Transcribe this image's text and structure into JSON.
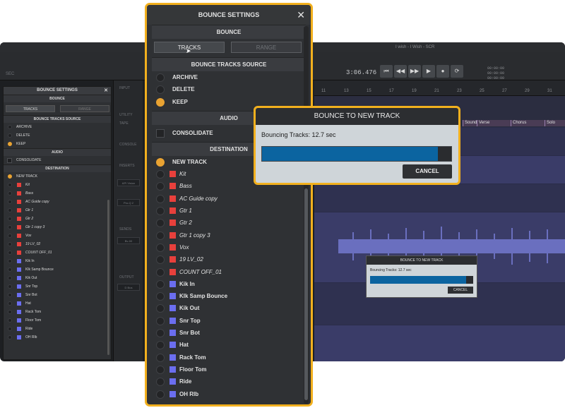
{
  "daw": {
    "window_title": "I wish - I Wish - SCR",
    "sec_label": "SEC",
    "counter": "3:06.476",
    "meta_times": [
      "00:00:00",
      "00:00:00",
      "00:00:00"
    ],
    "mid_labels": [
      "INPUT",
      "UTILITY",
      "TAPE",
      "CONSOLE",
      "INSERTS",
      "SENDS",
      "OUTPUT"
    ],
    "mid_slots": [
      "API Vision",
      "Pro-Q 2",
      "Bv-00",
      "D Bus"
    ],
    "ruler_numbers": [
      "11",
      "13",
      "15",
      "17",
      "19",
      "21",
      "23",
      "25",
      "27",
      "29",
      "31"
    ],
    "markers": [
      "Sound",
      "Verse",
      "Chorus",
      "Solo"
    ]
  },
  "small_settings": {
    "title": "BOUNCE SETTINGS",
    "section_bounce": "BOUNCE",
    "tab_tracks": "TRACKS",
    "tab_range": "RANGE",
    "section_source": "BOUNCE TRACKS SOURCE",
    "archive": "ARCHIVE",
    "delete": "DELETE",
    "keep": "KEEP",
    "section_audio": "AUDIO",
    "consolidate": "CONSOLIDATE",
    "section_destination": "DESTINATION",
    "new_track": "NEW TRACK"
  },
  "main_settings": {
    "title": "BOUNCE SETTINGS",
    "section_bounce": "BOUNCE",
    "tab_tracks": "TRACKS",
    "tab_range": "RANGE",
    "section_source": "BOUNCE TRACKS SOURCE",
    "archive": "ARCHIVE",
    "delete": "DELETE",
    "keep": "KEEP",
    "section_audio": "AUDIO",
    "consolidate": "CONSOLIDATE",
    "section_destination": "DESTINATION",
    "new_track": "NEW TRACK"
  },
  "tracks": [
    {
      "name": "Kit",
      "color": "#e8403c",
      "italic": true
    },
    {
      "name": "Bass",
      "color": "#e8403c",
      "italic": true
    },
    {
      "name": "AC Guide copy",
      "color": "#e8403c",
      "italic": true
    },
    {
      "name": "Gtr 1",
      "color": "#e8403c",
      "italic": true
    },
    {
      "name": "Gtr 2",
      "color": "#e8403c",
      "italic": true
    },
    {
      "name": "Gtr 1 copy 3",
      "color": "#e8403c",
      "italic": true
    },
    {
      "name": "Vox",
      "color": "#e8403c",
      "italic": true
    },
    {
      "name": "19 LV_02",
      "color": "#e8403c",
      "italic": true
    },
    {
      "name": "COUNT OFF_01",
      "color": "#e8403c",
      "italic": true
    },
    {
      "name": "Kik In",
      "color": "#6b6ef0",
      "italic": false
    },
    {
      "name": "Klk Samp Bounce",
      "color": "#6b6ef0",
      "italic": false
    },
    {
      "name": "Kik Out",
      "color": "#6b6ef0",
      "italic": false
    },
    {
      "name": "Snr Top",
      "color": "#6b6ef0",
      "italic": false
    },
    {
      "name": "Snr Bot",
      "color": "#6b6ef0",
      "italic": false
    },
    {
      "name": "Hat",
      "color": "#6b6ef0",
      "italic": false
    },
    {
      "name": "Rack Tom",
      "color": "#6b6ef0",
      "italic": false
    },
    {
      "name": "Floor Tom",
      "color": "#6b6ef0",
      "italic": false
    },
    {
      "name": "Ride",
      "color": "#6b6ef0",
      "italic": false
    },
    {
      "name": "OH Rlb",
      "color": "#6b6ef0",
      "italic": false
    }
  ],
  "big_dialog": {
    "title": "BOUNCE TO NEW TRACK",
    "message": "Bouncing Tracks: 12.7 sec",
    "progress": 0.93,
    "cancel": "CANCEL"
  },
  "small_dialog": {
    "title": "BOUNCE TO NEW TRACK",
    "message": "Bouncing Tracks: 12.7 sec",
    "progress": 0.93,
    "cancel": "CANCEL"
  },
  "colors": {
    "accent": "#f2b01e",
    "radio_on": "#e9a332",
    "progress": "#0b64a0"
  }
}
